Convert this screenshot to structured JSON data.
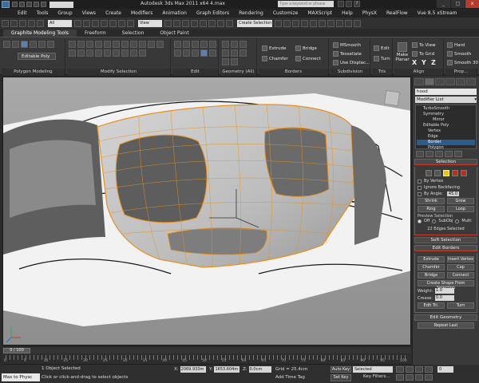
{
  "window": {
    "title": "Autodesk 3ds Max  2011 x64     4.max",
    "search_placeholder": "Type a keyword or phrase",
    "quick_combo": "",
    "buttons": [
      "_",
      "□",
      "x"
    ]
  },
  "menu": [
    "Edit",
    "Tools",
    "Group",
    "Views",
    "Create",
    "Modifiers",
    "Animation",
    "Graph Editors",
    "Rendering",
    "Customize",
    "MAXScript",
    "Help",
    "PhysX",
    "RealFlow",
    "Vue 8.5 xStream"
  ],
  "toolbar": {
    "filter": "All",
    "view": "View",
    "named_sel": "Create Selection Se"
  },
  "ribbon": {
    "tabs": [
      "Graphite Modeling Tools",
      "Freeform",
      "Selection",
      "Object Paint"
    ],
    "active_tab": 0,
    "edit_poly_label": "Editable Poly",
    "groups": [
      {
        "label": "Polygon Modeling"
      },
      {
        "label": "Modify Selection"
      },
      {
        "label": "Edit"
      },
      {
        "label": "Geometry (All)"
      },
      {
        "label": "Borders"
      },
      {
        "label": "Subdivision"
      },
      {
        "label": "Tris"
      },
      {
        "label": "Align"
      },
      {
        "label": "Prop..."
      }
    ],
    "borders": {
      "extrude": "Extrude",
      "chamfer": "Chamfer",
      "bridge": "Bridge",
      "connect": "Connect"
    },
    "subdivision": {
      "msmooth": "MSmooth",
      "tessellate": "Tessellate",
      "use_displac": "Use Displac..."
    },
    "tris": {
      "edit": "Edit",
      "turn": "Turn"
    },
    "align": {
      "make_planar": "Make Planar",
      "to_view": "To View",
      "to_grid": "To Grid",
      "x": "X",
      "y": "Y",
      "z": "Z"
    },
    "props": {
      "hard": "Hard",
      "smooth": "Smooth",
      "smooth30": "Smooth 30"
    }
  },
  "viewport": {
    "label": ""
  },
  "command_panel": {
    "object_name": "hood",
    "modifier_list": "Modifier List",
    "stack": [
      {
        "label": "TurboSmooth",
        "level": 0
      },
      {
        "label": "Symmetry",
        "level": 0
      },
      {
        "label": "Mirror",
        "level": 2
      },
      {
        "label": "Editable Poly",
        "level": 0
      },
      {
        "label": "Vertex",
        "level": 1
      },
      {
        "label": "Edge",
        "level": 1
      },
      {
        "label": "Border",
        "level": 1,
        "selected": true
      },
      {
        "label": "Polygon",
        "level": 1
      }
    ],
    "selection": {
      "title": "Selection",
      "by_vertex": "By Vertex",
      "ignore_backfacing": "Ignore Backfacing",
      "by_angle": "By Angle:",
      "by_angle_value": "45.0",
      "shrink": "Shrink",
      "grow": "Grow",
      "ring": "Ring",
      "loop": "Loop",
      "preview_title": "Preview Selection",
      "preview_off": "Off",
      "preview_subobj": "SubObj",
      "preview_multi": "Multi",
      "status": "22 Edges Selected"
    },
    "soft_selection": "Soft Selection",
    "edit_borders": {
      "title": "Edit Borders",
      "extrude": "Extrude",
      "insert_vertex": "Insert Vertex",
      "chamfer": "Chamfer",
      "cap": "Cap",
      "bridge": "Bridge",
      "connect": "Connect",
      "create_shape": "Create Shape From Selection",
      "weight_label": "Weight:",
      "weight_value": "1.0",
      "crease_label": "Crease:",
      "crease_value": "0.0",
      "edit_tri": "Edit Tri.",
      "turn": "Turn"
    },
    "edit_geometry": "Edit Geometry",
    "repeat_last": "Repeat Last"
  },
  "timeline": {
    "frame_label": "0 / 100",
    "ticks": [
      "0",
      "5",
      "10",
      "15",
      "20",
      "25",
      "30",
      "35",
      "40",
      "45",
      "50",
      "55",
      "60",
      "65",
      "70",
      "75",
      "80",
      "85",
      "90",
      "95",
      "100"
    ]
  },
  "status": {
    "listener": "Max to Physc",
    "selected_count": "1 Object Selected",
    "prompt": "Click or click-and-drag to select objects",
    "x_label": "X:",
    "x_value": "2069.933m",
    "y_label": "Y:",
    "y_value": "1653.604m",
    "z_label": "Z:",
    "z_value": "0.0cm",
    "grid": "Grid = 25.4cm",
    "add_time_tag": "Add Time Tag",
    "auto_key": "Auto Key",
    "set_key": "Set Key",
    "selected": "Selected",
    "key_filters": "Key Filters...",
    "frame": "0"
  },
  "colors": {
    "selection_orange": "#e89020",
    "viewport_bg": "#9e9e9e",
    "highlight": "#2d5c8a"
  }
}
